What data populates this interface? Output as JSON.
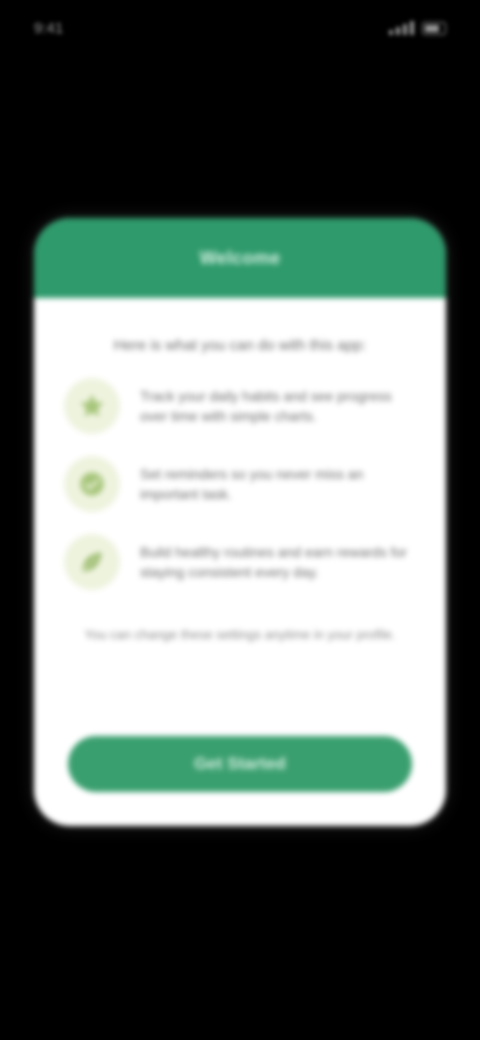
{
  "status_bar": {
    "time": "9:41"
  },
  "dialog": {
    "title": "Welcome",
    "intro": "Here is what you can do with this app:",
    "features": [
      {
        "icon": "star-icon",
        "text": "Track your daily habits and see progress over time with simple charts."
      },
      {
        "icon": "check-icon",
        "text": "Set reminders so you never miss an important task."
      },
      {
        "icon": "leaf-icon",
        "text": "Build healthy routines and earn rewards for staying consistent every day."
      }
    ],
    "note": "You can change these settings anytime in your profile.",
    "cta_label": "Get Started"
  },
  "colors": {
    "header": "#2f9a6c",
    "cta": "#3a9f6f",
    "icon_bg": "#eef3de",
    "icon_fg": "#a6c57a"
  }
}
